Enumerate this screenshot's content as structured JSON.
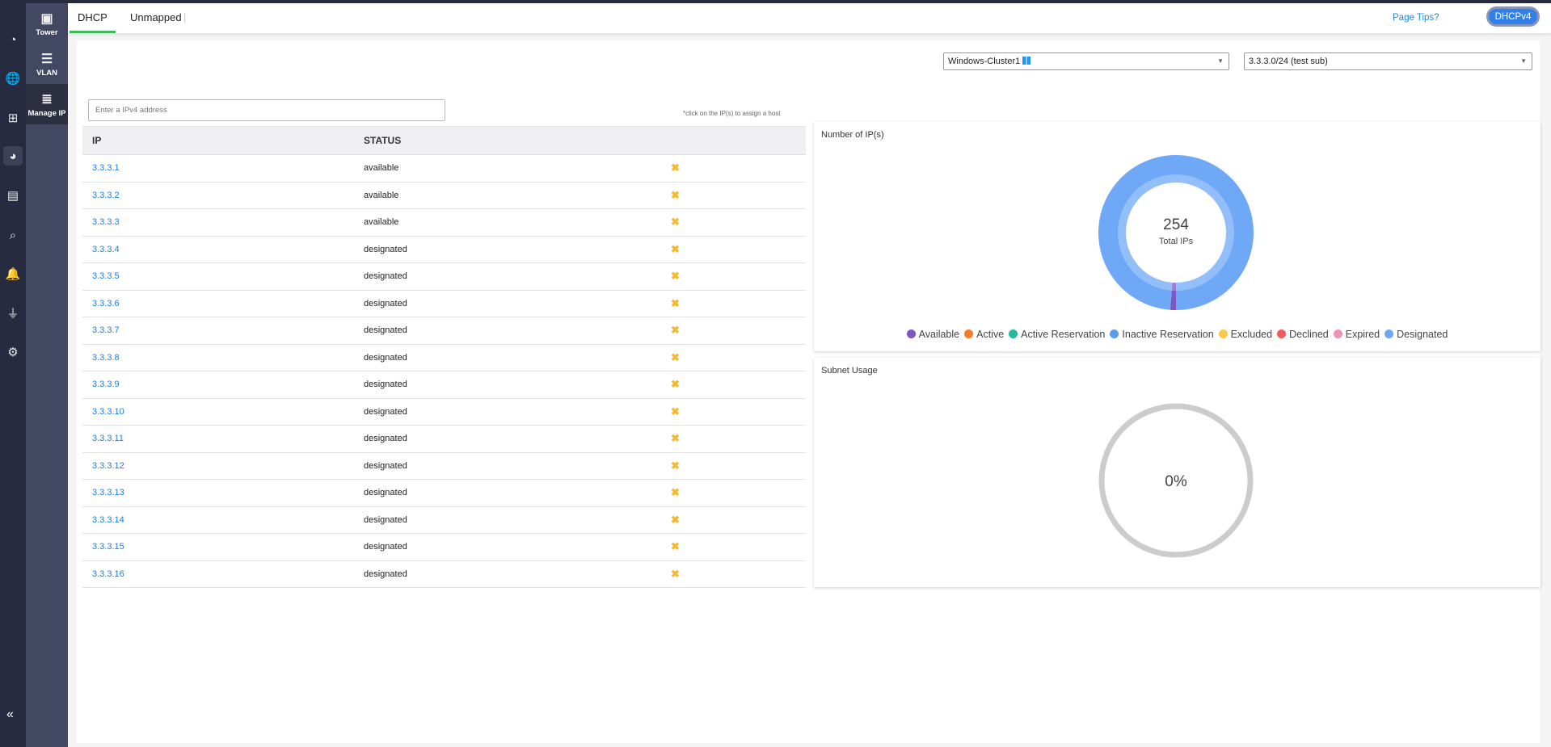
{
  "rail": {
    "icons": [
      "dashboard-icon",
      "dns-globe-icon",
      "network-tree-icon",
      "ipam-chart-icon",
      "server-shield-icon",
      "search-analytics-icon",
      "bell-icon",
      "plug-icon",
      "settings-gear-icon"
    ],
    "collapse": "«"
  },
  "subnav": [
    {
      "label": "Tower",
      "icon": "tower-icon"
    },
    {
      "label": "VLAN",
      "icon": "vlan-icon"
    },
    {
      "label": "Manage IP",
      "icon": "manage-ip-icon"
    }
  ],
  "header": {
    "tabs": [
      "DHCP",
      "Unmapped"
    ],
    "page_tips": "Page Tips?",
    "mode": "DHCPv4",
    "accent": "#3cb95a"
  },
  "filters": {
    "cluster": "Windows-Cluster1",
    "subnet": "3.3.3.0/24 (test sub)"
  },
  "search": {
    "placeholder": "Enter a IPv4 address"
  },
  "hint": "*click on the IP(s) to assign a host",
  "table": {
    "columns": [
      "IP",
      "STATUS"
    ],
    "rows": [
      {
        "ip": "3.3.3.1",
        "status": "available"
      },
      {
        "ip": "3.3.3.2",
        "status": "available"
      },
      {
        "ip": "3.3.3.3",
        "status": "available"
      },
      {
        "ip": "3.3.3.4",
        "status": "designated"
      },
      {
        "ip": "3.3.3.5",
        "status": "designated"
      },
      {
        "ip": "3.3.3.6",
        "status": "designated"
      },
      {
        "ip": "3.3.3.7",
        "status": "designated"
      },
      {
        "ip": "3.3.3.8",
        "status": "designated"
      },
      {
        "ip": "3.3.3.9",
        "status": "designated"
      },
      {
        "ip": "3.3.3.10",
        "status": "designated"
      },
      {
        "ip": "3.3.3.11",
        "status": "designated"
      },
      {
        "ip": "3.3.3.12",
        "status": "designated"
      },
      {
        "ip": "3.3.3.13",
        "status": "designated"
      },
      {
        "ip": "3.3.3.14",
        "status": "designated"
      },
      {
        "ip": "3.3.3.15",
        "status": "designated"
      },
      {
        "ip": "3.3.3.16",
        "status": "designated"
      }
    ]
  },
  "ip_chart": {
    "title": "Number of IP(s)",
    "total": "254",
    "total_label": "Total IPs",
    "legend": [
      {
        "label": "Available",
        "color": "#7e57c2",
        "value": 3
      },
      {
        "label": "Active",
        "color": "#f57c2b",
        "value": 0
      },
      {
        "label": "Active Reservation",
        "color": "#26b99a",
        "value": 0
      },
      {
        "label": "Inactive Reservation",
        "color": "#5c9bef",
        "value": 0
      },
      {
        "label": "Excluded",
        "color": "#fbc848",
        "value": 0
      },
      {
        "label": "Declined",
        "color": "#f25b5b",
        "value": 0
      },
      {
        "label": "Expired",
        "color": "#f093b0",
        "value": 0
      },
      {
        "label": "Designated",
        "color": "#6ea8f7",
        "value": 251
      }
    ]
  },
  "usage": {
    "title": "Subnet Usage",
    "value": "0%",
    "percent": 0
  }
}
